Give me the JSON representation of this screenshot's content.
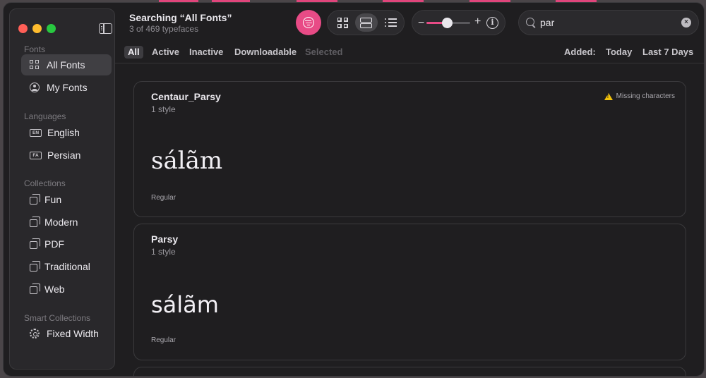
{
  "window": {
    "title": "Searching “All Fonts”",
    "subtitle": "3 of 469 typefaces"
  },
  "colors": {
    "accent": "#e84b86",
    "close": "#ff5f57",
    "minimize": "#febc2e",
    "zoom": "#28c840"
  },
  "sidebar": {
    "sections": [
      {
        "heading": "Fonts",
        "items": [
          {
            "label": "All Fonts",
            "icon": "grid-icon",
            "active": true
          },
          {
            "label": "My Fonts",
            "icon": "person-circle-icon"
          }
        ]
      },
      {
        "heading": "Languages",
        "items": [
          {
            "label": "English",
            "badge": "EN"
          },
          {
            "label": "Persian",
            "badge": "FA"
          }
        ]
      },
      {
        "heading": "Collections",
        "items": [
          {
            "label": "Fun",
            "icon": "collection-icon"
          },
          {
            "label": "Modern",
            "icon": "collection-icon"
          },
          {
            "label": "PDF",
            "icon": "collection-icon"
          },
          {
            "label": "Traditional",
            "icon": "collection-icon"
          },
          {
            "label": "Web",
            "icon": "collection-icon"
          }
        ]
      },
      {
        "heading": "Smart Collections",
        "items": [
          {
            "label": "Fixed Width",
            "icon": "gear-icon"
          }
        ]
      }
    ]
  },
  "toolbar": {
    "slider_value": 0.47,
    "search_value": "par",
    "clear_glyph": "×",
    "minus_glyph": "−",
    "plus_glyph": "+",
    "info_glyph": "i"
  },
  "filters": {
    "tabs": [
      "All",
      "Active",
      "Inactive",
      "Downloadable",
      "Selected"
    ],
    "added_label": "Added:",
    "added_options": [
      "Today",
      "Last 7 Days"
    ]
  },
  "fonts": [
    {
      "name": "Centaur_Parsy",
      "styles": "1 style",
      "sample": "sálãm",
      "style": "Regular",
      "warning": "Missing characters"
    },
    {
      "name": "Parsy",
      "styles": "1 style",
      "sample": "sálãm",
      "style": "Regular"
    }
  ]
}
